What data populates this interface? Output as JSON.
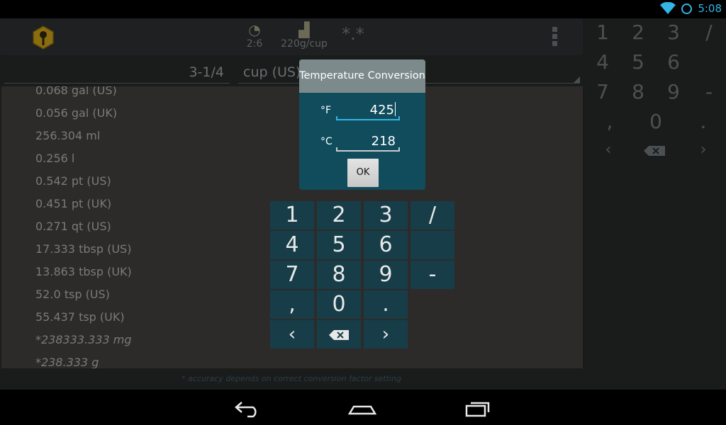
{
  "status_bar": {
    "time": "5:08",
    "icons": [
      "wifi-icon",
      "sync-icon"
    ]
  },
  "action_bar": {
    "logo_icon": "recipe-app-logo",
    "ratio_label": "2:6",
    "ratio_icon": "scale-icon",
    "density_label": "220g/cup",
    "density_icon": "measuring-jug-icon",
    "format_label": "*.*",
    "overflow_icon": "overflow-menu-icon"
  },
  "input": {
    "amount": "3-1/4",
    "unit": "cup (US)"
  },
  "results": [
    {
      "text": "0.068 gal (US)",
      "estimate": false
    },
    {
      "text": "0.056 gal (UK)",
      "estimate": false
    },
    {
      "text": "256.304 ml",
      "estimate": false
    },
    {
      "text": "0.256 l",
      "estimate": false
    },
    {
      "text": "0.542 pt (US)",
      "estimate": false
    },
    {
      "text": "0.451 pt (UK)",
      "estimate": false
    },
    {
      "text": "0.271 qt (US)",
      "estimate": false
    },
    {
      "text": "17.333 tbsp (US)",
      "estimate": false
    },
    {
      "text": "13.863 tbsp (UK)",
      "estimate": false
    },
    {
      "text": "52.0 tsp (US)",
      "estimate": false
    },
    {
      "text": "55.437 tsp (UK)",
      "estimate": false
    },
    {
      "text": "*238333.333 mg",
      "estimate": true
    },
    {
      "text": "*238.333 g",
      "estimate": true
    }
  ],
  "footer_note": "* accuracy depends on correct conversion factor setting",
  "dialog": {
    "title": "Temperature Conversion",
    "fahrenheit_label": "°F",
    "fahrenheit_value": "425",
    "celsius_label": "°C",
    "celsius_value": "218",
    "ok_label": "OK"
  },
  "keypad": {
    "keys": [
      "1",
      "2",
      "3",
      "/",
      "4",
      "5",
      "6",
      "",
      "7",
      "8",
      "9",
      "-",
      ",",
      "0",
      ".",
      "‹",
      "",
      "›"
    ],
    "backspace_icon": "backspace-icon"
  },
  "side_keypad": {
    "keys": [
      "1",
      "2",
      "3",
      "/",
      "4",
      "5",
      "6",
      "7",
      "8",
      "9",
      "-",
      ",",
      "0",
      ".",
      "‹",
      "›"
    ]
  },
  "nav_bar": {
    "buttons": [
      "back-icon",
      "home-icon",
      "recent-apps-icon"
    ]
  },
  "colors": {
    "accent": "#33b5e5",
    "dialog_bg": "#104c5c",
    "key_bg": "#173d49"
  }
}
